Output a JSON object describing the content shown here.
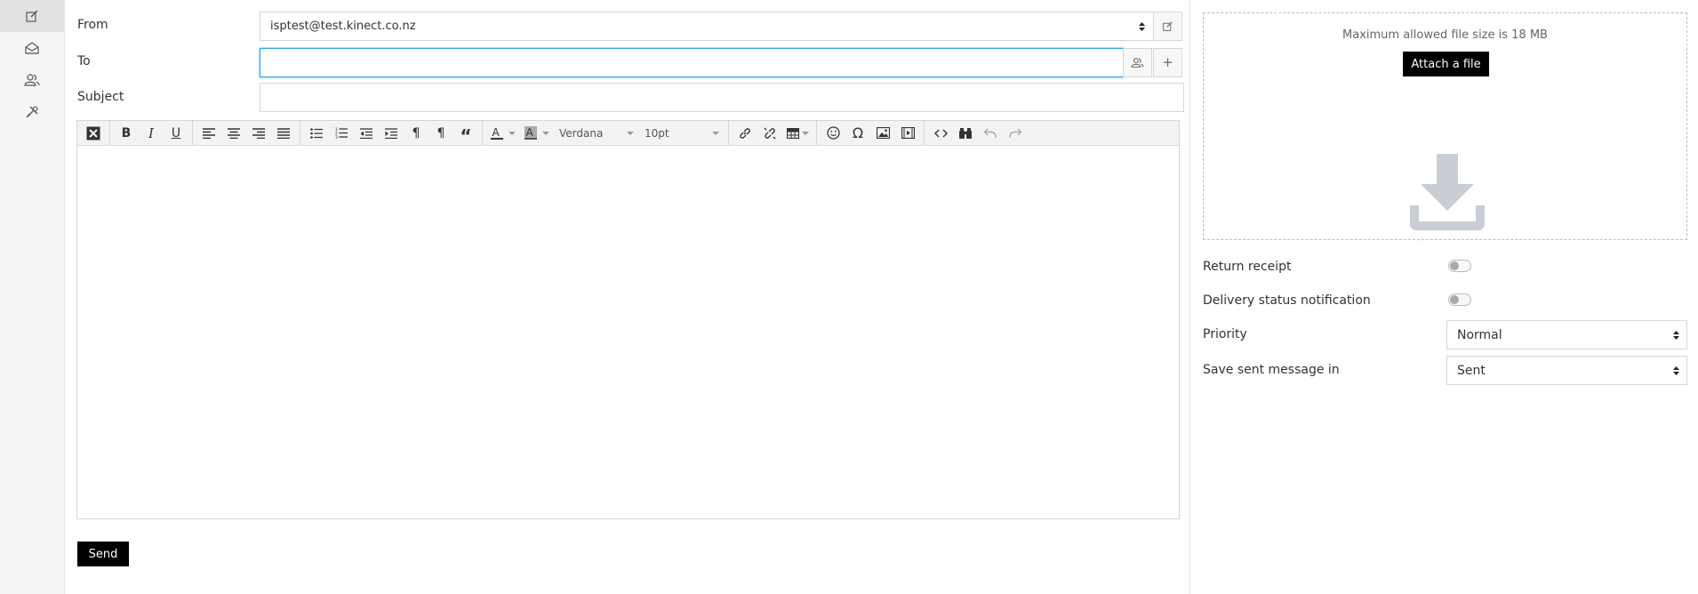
{
  "rail": {
    "items": [
      {
        "icon": "compose-icon",
        "active": true
      },
      {
        "icon": "mail-icon",
        "active": false
      },
      {
        "icon": "contacts-icon",
        "active": false
      },
      {
        "icon": "settings-icon",
        "active": false
      }
    ]
  },
  "compose": {
    "from_label": "From",
    "from_value": "isptest@test.kinect.co.nz",
    "to_label": "To",
    "to_value": "",
    "subject_label": "Subject",
    "subject_value": "",
    "send_label": "Send"
  },
  "toolbar": {
    "font_family": "Verdana",
    "font_size": "10pt"
  },
  "attachments": {
    "max_size_text": "Maximum allowed file size is 18 MB",
    "attach_label": "Attach a file"
  },
  "options": {
    "return_receipt_label": "Return receipt",
    "return_receipt_on": false,
    "dsn_label": "Delivery status notification",
    "dsn_on": false,
    "priority_label": "Priority",
    "priority_value": "Normal",
    "save_sent_label": "Save sent message in",
    "save_sent_value": "Sent"
  },
  "colors": {
    "accent_focus": "#33a2e0",
    "button_bg": "#000000"
  }
}
